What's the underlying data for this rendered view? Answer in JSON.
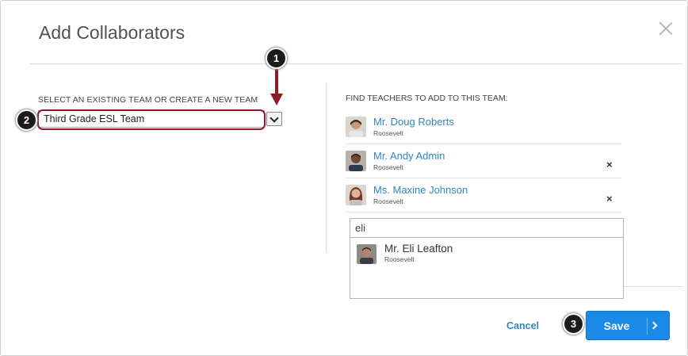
{
  "dialog": {
    "title": "Add Collaborators"
  },
  "team": {
    "label": "SELECT AN EXISTING TEAM OR CREATE A NEW TEAM",
    "selected": "Third Grade ESL Team"
  },
  "teachers": {
    "label": "FIND TEACHERS TO ADD TO THIS TEAM:",
    "list": [
      {
        "name": "Mr. Doug Roberts",
        "school": "Roosevelt",
        "removable": false
      },
      {
        "name": "Mr. Andy Admin",
        "school": "Roosevelt",
        "removable": true,
        "remove_symbol": "×"
      },
      {
        "name": "Ms. Maxine Johnson",
        "school": "Roosevelt",
        "removable": true,
        "remove_symbol": "×"
      }
    ]
  },
  "search": {
    "value": "eli",
    "results": [
      {
        "name": "Mr. Eli Leafton",
        "school": "Roosevelt"
      }
    ]
  },
  "footer": {
    "cancel_label": "Cancel",
    "save_label": "Save"
  },
  "callouts": [
    "1",
    "2",
    "3"
  ],
  "colors": {
    "accent": "#1b8ae6",
    "link": "#2f87c4",
    "annotation": "#8e1b25"
  }
}
